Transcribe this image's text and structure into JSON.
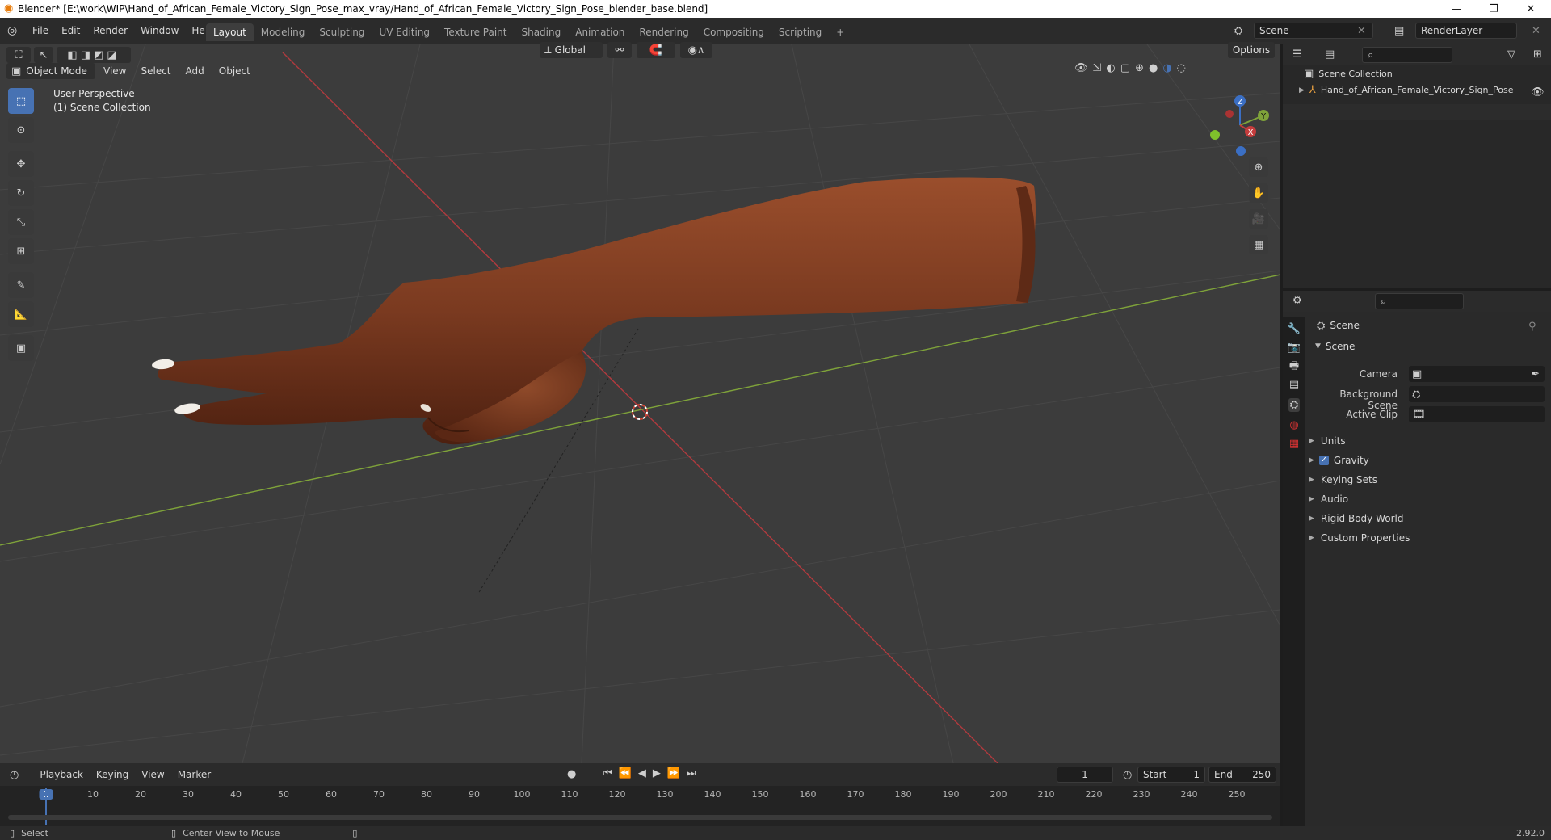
{
  "titlebar": {
    "title": "Blender* [E:\\work\\WIP\\Hand_of_African_Female_Victory_Sign_Pose_max_vray/Hand_of_African_Female_Victory_Sign_Pose_blender_base.blend]"
  },
  "menu": [
    "File",
    "Edit",
    "Render",
    "Window",
    "Help"
  ],
  "workspaces": [
    "Layout",
    "Modeling",
    "Sculpting",
    "UV Editing",
    "Texture Paint",
    "Shading",
    "Animation",
    "Rendering",
    "Compositing",
    "Scripting"
  ],
  "active_workspace": "Layout",
  "scene_field": "Scene",
  "render_layer_field": "RenderLayer",
  "viewport_header": {
    "transform_orientation": "Global",
    "options": "Options",
    "mode": "Object Mode",
    "menus": [
      "View",
      "Select",
      "Add",
      "Object"
    ]
  },
  "viewport_overlay": {
    "line1": "User Perspective",
    "line2": "(1) Scene Collection"
  },
  "gizmo": {
    "z": "Z",
    "y": "Y",
    "x": "X"
  },
  "outliner": {
    "root": "Scene Collection",
    "item": "Hand_of_African_Female_Victory_Sign_Pose"
  },
  "properties": {
    "context": "Scene",
    "panel": "Scene",
    "camera_label": "Camera",
    "background_label": "Background Scene",
    "clip_label": "Active Clip",
    "sections": [
      "Units",
      "Gravity",
      "Keying Sets",
      "Audio",
      "Rigid Body World",
      "Custom Properties"
    ]
  },
  "timeline": {
    "menus": [
      "Playback",
      "Keying",
      "View",
      "Marker"
    ],
    "current_frame": "1",
    "start_label": "Start",
    "start_value": "1",
    "end_label": "End",
    "end_value": "250",
    "ticks": [
      "1",
      "10",
      "20",
      "30",
      "40",
      "50",
      "60",
      "70",
      "80",
      "90",
      "100",
      "110",
      "120",
      "130",
      "140",
      "150",
      "160",
      "170",
      "180",
      "190",
      "200",
      "210",
      "220",
      "230",
      "240",
      "250"
    ]
  },
  "statusbar": {
    "select": "Select",
    "center": "Center View to Mouse",
    "version": "2.92.0"
  },
  "colors": {
    "accent": "#4772b3",
    "x_axis": "#c2393f",
    "y_axis": "#7fa33a",
    "skin": "#7a3a20"
  }
}
